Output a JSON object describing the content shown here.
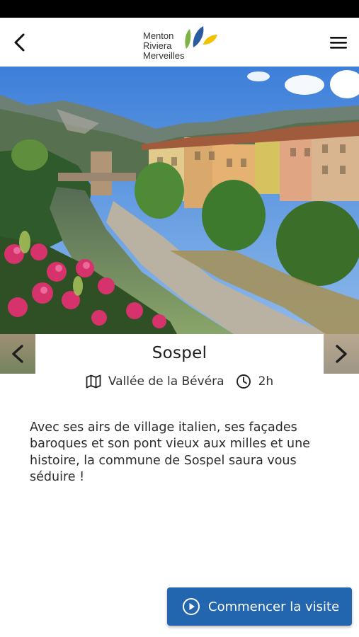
{
  "header": {
    "logo_line1": "Menton",
    "logo_line2": "Riviera",
    "logo_line3": "Merveilles",
    "back_icon": "chevron-left-icon",
    "menu_icon": "hamburger-menu-icon"
  },
  "place": {
    "title": "Sospel",
    "area": "Vallée de la Bévéra",
    "duration": "2h",
    "description": "Avec ses airs de village italien, ses façades baroques et son pont vieux aux milles et une histoire, la commune de Sospel saura vous séduire !"
  },
  "actions": {
    "start_label": "Commencer la visite"
  },
  "colors": {
    "accent": "#2166ae",
    "logo_blue": "#2a5aa0",
    "logo_green": "#7cb342",
    "logo_yellow": "#f2c200"
  }
}
